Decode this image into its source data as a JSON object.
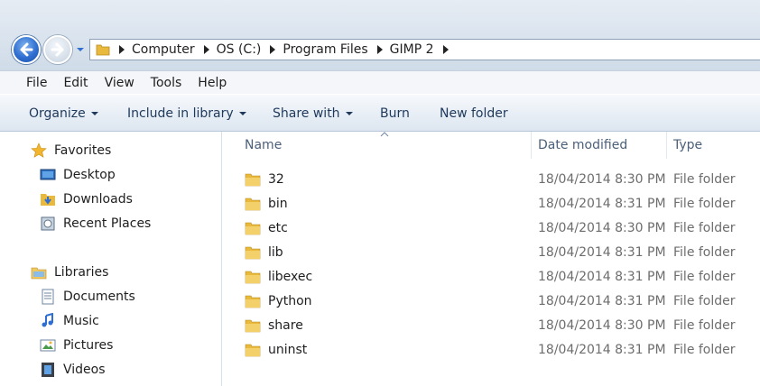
{
  "window": {
    "title": "GIMP 2"
  },
  "navigation": {
    "back_icon": "back-arrow-icon",
    "forward_icon": "forward-arrow-icon",
    "recent_icon": "chevron-down-icon"
  },
  "address": {
    "crumbs": [
      "Computer",
      "OS (C:)",
      "Program Files",
      "GIMP 2"
    ]
  },
  "menu": {
    "items": [
      "File",
      "Edit",
      "View",
      "Tools",
      "Help"
    ]
  },
  "toolbar": {
    "organize": "Organize",
    "include": "Include in library",
    "share": "Share with",
    "burn": "Burn",
    "new_folder": "New folder"
  },
  "sidebar": {
    "favorites": {
      "label": "Favorites",
      "items": [
        "Desktop",
        "Downloads",
        "Recent Places"
      ]
    },
    "libraries": {
      "label": "Libraries",
      "items": [
        "Documents",
        "Music",
        "Pictures",
        "Videos"
      ]
    }
  },
  "columns": {
    "name": "Name",
    "date": "Date modified",
    "type": "Type"
  },
  "files": [
    {
      "name": "32",
      "date": "18/04/2014 8:30 PM",
      "type": "File folder"
    },
    {
      "name": "bin",
      "date": "18/04/2014 8:31 PM",
      "type": "File folder"
    },
    {
      "name": "etc",
      "date": "18/04/2014 8:30 PM",
      "type": "File folder"
    },
    {
      "name": "lib",
      "date": "18/04/2014 8:31 PM",
      "type": "File folder"
    },
    {
      "name": "libexec",
      "date": "18/04/2014 8:31 PM",
      "type": "File folder"
    },
    {
      "name": "Python",
      "date": "18/04/2014 8:31 PM",
      "type": "File folder"
    },
    {
      "name": "share",
      "date": "18/04/2014 8:30 PM",
      "type": "File folder"
    },
    {
      "name": "uninst",
      "date": "18/04/2014 8:31 PM",
      "type": "File folder"
    }
  ],
  "colors": {
    "accent": "#2f6fd1",
    "toolbar_text": "#1e395b",
    "folder": "#e8b93c"
  }
}
